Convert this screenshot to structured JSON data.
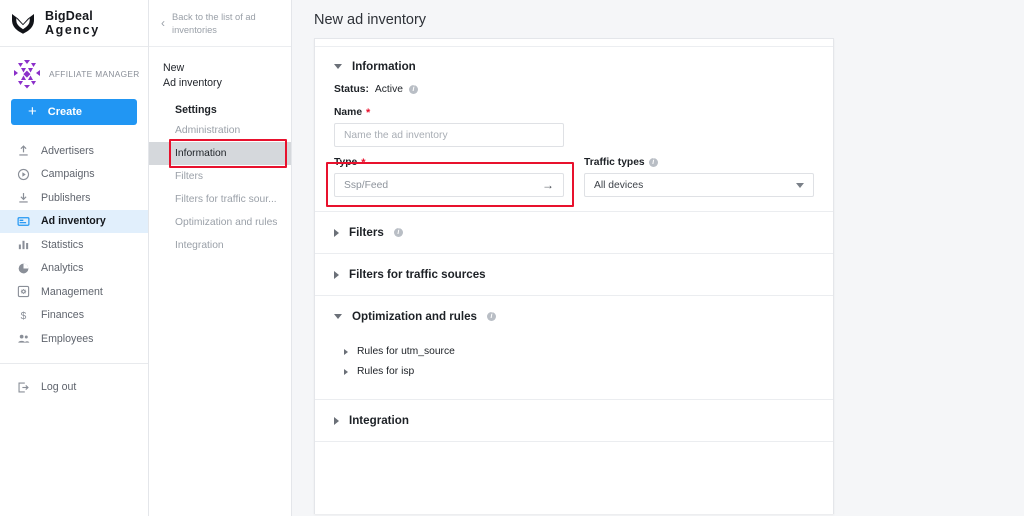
{
  "brand": {
    "logo_icon": "shield-chevron-logo",
    "name_line1": "BigDeal",
    "name_line2": "Agency"
  },
  "account": {
    "avatar_icon": "geometric-avatar",
    "role": "AFFILIATE MANAGER",
    "accent": "#8b2fc9"
  },
  "create": {
    "label": "Create",
    "icon": "plus-icon",
    "color": "#2196f3"
  },
  "sidebar": {
    "items": [
      {
        "label": "Advertisers",
        "icon": "upload-arrow-icon",
        "active": false
      },
      {
        "label": "Campaigns",
        "icon": "play-circle-icon",
        "active": false
      },
      {
        "label": "Publishers",
        "icon": "download-arrow-icon",
        "active": false
      },
      {
        "label": "Ad inventory",
        "icon": "ad-banner-icon",
        "active": true
      },
      {
        "label": "Statistics",
        "icon": "bar-chart-icon",
        "active": false
      },
      {
        "label": "Analytics",
        "icon": "pie-chart-icon",
        "active": false
      },
      {
        "label": "Management",
        "icon": "settings-square-icon",
        "active": false
      },
      {
        "label": "Finances",
        "icon": "dollar-sign-icon",
        "active": false
      },
      {
        "label": "Employees",
        "icon": "people-icon",
        "active": false
      }
    ],
    "logout": {
      "label": "Log out",
      "icon": "logout-arrow-icon"
    },
    "active_bg": "#e1effc"
  },
  "subnav": {
    "back": {
      "label": "Back to the list of ad inventories",
      "icon": "chevron-left-icon"
    },
    "title_line1": "New",
    "title_line2": "Ad inventory",
    "group": "Settings",
    "items": [
      {
        "label": "Administration",
        "selected": false
      },
      {
        "label": "Information",
        "selected": true
      },
      {
        "label": "Filters",
        "selected": false
      },
      {
        "label": "Filters for traffic sour...",
        "selected": false
      },
      {
        "label": "Optimization and rules",
        "selected": false
      },
      {
        "label": "Integration",
        "selected": false
      }
    ],
    "selected_bg": "#d5d8dc",
    "highlight_color": "#e8112d"
  },
  "main": {
    "page_title": "New ad inventory",
    "information": {
      "title": "Information",
      "expanded": true,
      "status_label": "Status:",
      "status_value": "Active",
      "status_info_icon": "info-icon",
      "name": {
        "label": "Name",
        "required": true,
        "value": "",
        "placeholder": "Name the ad inventory"
      },
      "type": {
        "label": "Type",
        "required": true,
        "value": "Ssp/Feed",
        "icon": "arrow-right-icon",
        "highlighted": true
      },
      "traffic_types": {
        "label": "Traffic types",
        "info_icon": "info-icon",
        "value": "All devices",
        "icon": "chevron-down-icon"
      }
    },
    "sections": [
      {
        "title": "Filters",
        "expanded": false,
        "info_icon": "info-icon"
      },
      {
        "title": "Filters for traffic sources",
        "expanded": false,
        "info_icon": null
      },
      {
        "title": "Optimization and rules",
        "expanded": true,
        "info_icon": "info-icon",
        "rules": [
          {
            "label": "Rules for utm_source"
          },
          {
            "label": "Rules for isp"
          }
        ]
      },
      {
        "title": "Integration",
        "expanded": false,
        "info_icon": null
      }
    ]
  }
}
